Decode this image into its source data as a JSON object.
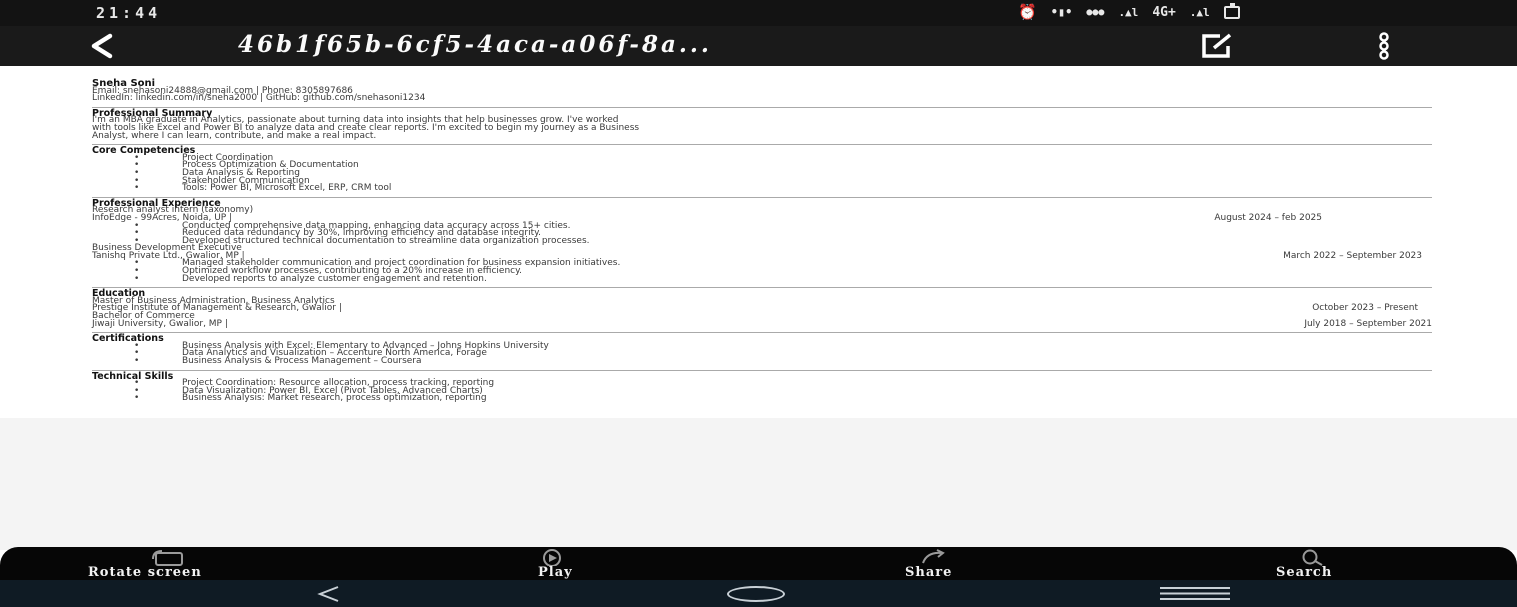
{
  "status_bar": {
    "time": "21:44",
    "network": "4G+"
  },
  "app_bar": {
    "title": "46b1f65b-6cf5-4aca-a06f-8a..."
  },
  "resume": {
    "name": "Sneha Soni",
    "contact_line1": "Email: snehasoni24888@gmail.com | Phone: 8305897686",
    "contact_line2": "LinkedIn: linkedin.com/in/sneha2000 | GitHub: github.com/snehasoni1234",
    "summary_title": "Professional Summary",
    "summary_lines": [
      "I'm an MBA graduate in Analytics, passionate about turning data into insights that help businesses grow. I've worked",
      "with tools like Excel and Power BI to analyze data and create clear reports. I'm excited to begin my journey as a Business",
      "Analyst, where I can learn, contribute, and make a real impact."
    ],
    "competencies_title": "Core Competencies",
    "competencies": [
      "Project Coordination",
      "Process Optimization & Documentation",
      "Data Analysis & Reporting",
      "Stakeholder Communication",
      "Tools: Power BI, Microsoft Excel, ERP, CRM tool"
    ],
    "experience_title": "Professional Experience",
    "jobs": [
      {
        "role": "Research analyst intern (taxonomy)",
        "company": "InfoEdge - 99Acres, Noida, UP |",
        "dates": "August 2024 – feb 2025",
        "bullets": [
          "Conducted comprehensive data mapping, enhancing data accuracy across 15+ cities.",
          "Reduced data redundancy by 30%, improving efficiency and database integrity.",
          "Developed structured technical documentation to streamline data organization processes."
        ]
      },
      {
        "role": "Business Development Executive",
        "company": "Tanishq Private Ltd., Gwalior, MP |",
        "dates": "March 2022 – September 2023",
        "bullets": [
          "Managed stakeholder communication and project coordination for business expansion initiatives.",
          "Optimized workflow processes, contributing to a 20% increase in efficiency.",
          "Developed reports to analyze customer engagement and retention."
        ]
      }
    ],
    "education_title": "Education",
    "education": [
      {
        "degree": "Master of Business Administration, Business Analytics",
        "school": "Prestige Institute of Management & Research, Gwalior |",
        "dates": "October 2023 – Present"
      },
      {
        "degree": "Bachelor of Commerce",
        "school": "Jiwaji University, Gwalior, MP |",
        "dates": "July 2018 – September 2021"
      }
    ],
    "certifications_title": "Certifications",
    "certifications": [
      "Business Analysis with Excel: Elementary to Advanced – Johns Hopkins University",
      "Data Analytics and Visualization – Accenture North America, Forage",
      "Business Analysis & Process Management – Coursera"
    ],
    "skills_title": "Technical Skills",
    "skills": [
      "Project Coordination: Resource allocation, process tracking, reporting",
      "Data Visualization: Power BI, Excel (Pivot Tables, Advanced Charts)",
      "Business Analysis: Market research, process optimization, reporting"
    ]
  },
  "actions": {
    "rotate": "Rotate screen",
    "play": "Play",
    "share": "Share",
    "search": "Search"
  },
  "icons": {
    "back": "back-arrow-icon",
    "edit": "edit-icon",
    "more": "more-vertical-icon",
    "rotate": "rotate-screen-icon",
    "play": "play-icon",
    "share": "share-icon",
    "search": "search-icon"
  }
}
